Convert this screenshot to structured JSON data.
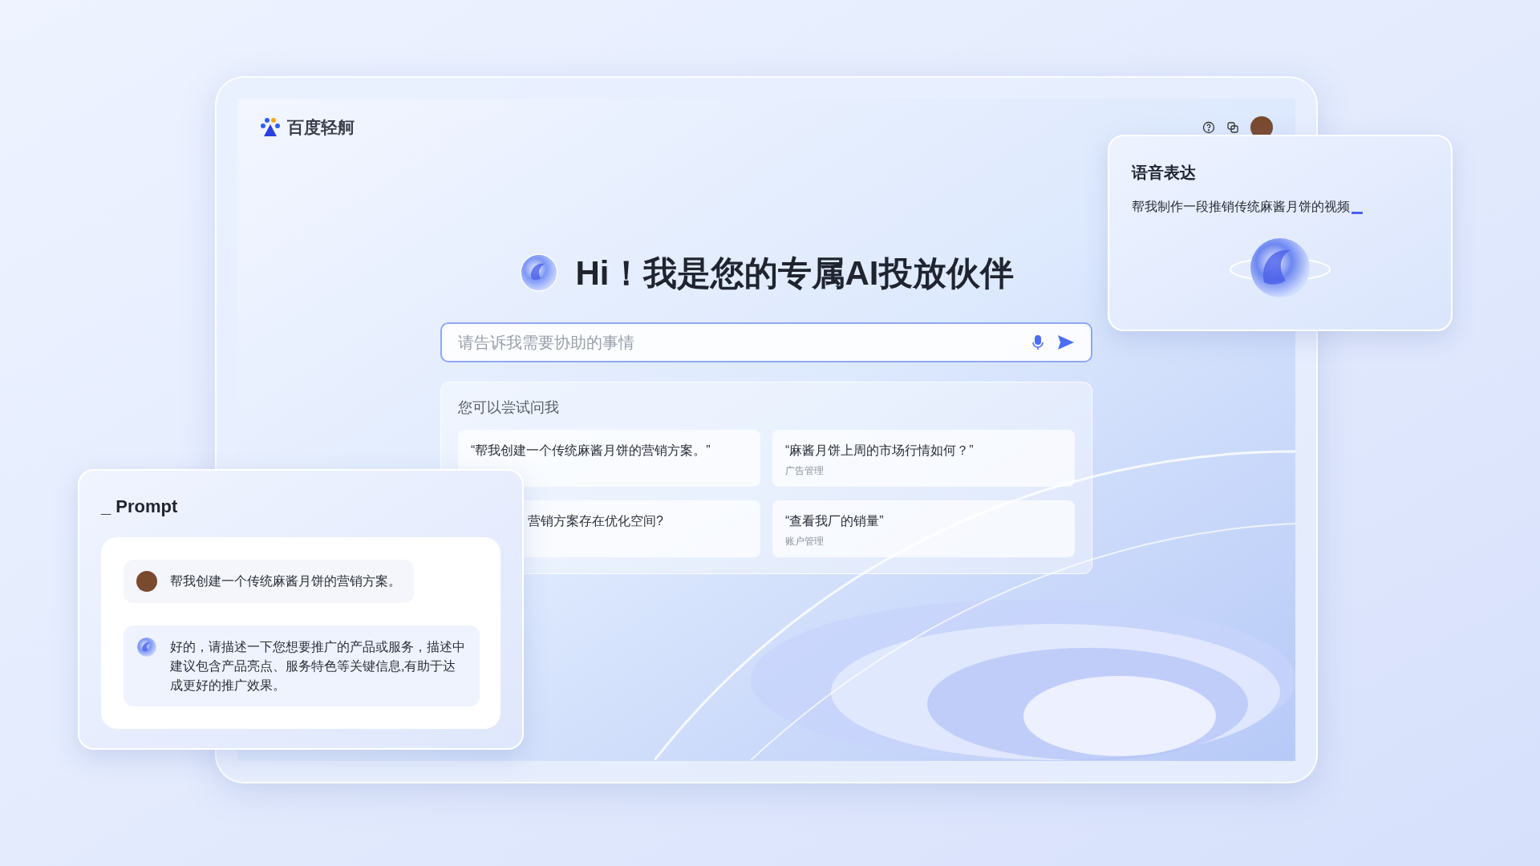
{
  "app": {
    "logo_text": "百度轻舸"
  },
  "greeting": "Hi！我是您的专属AI投放伙伴",
  "search": {
    "placeholder": "请告诉我需要协助的事情"
  },
  "suggestions": {
    "title": "您可以尝试问我",
    "items": [
      {
        "kind": "full",
        "text": "“帮我创建一个传统麻酱月饼的营销方案。”"
      },
      {
        "kind": "full",
        "text": "“麻酱月饼上周的市场行情如何？”",
        "category": "广告管理"
      },
      {
        "kind": "clipped",
        "text": "营销方案存在优化空间?"
      },
      {
        "kind": "full",
        "text": "“查看我厂的销量”",
        "category": "账户管理"
      }
    ]
  },
  "prompt_card": {
    "title": "_ Prompt",
    "messages": [
      {
        "kind": "user",
        "text": "帮我创建一个传统麻酱月饼的营销方案。"
      },
      {
        "kind": "assistant",
        "text": "好的，请描述一下您想要推广的产品或服务，描述中建议包含产品亮点、服务特色等关键信息,有助于达成更好的推广效果。"
      }
    ]
  },
  "voice_card": {
    "title": "语音表达",
    "text": "帮我制作一段推销传统麻酱月饼的视频"
  }
}
